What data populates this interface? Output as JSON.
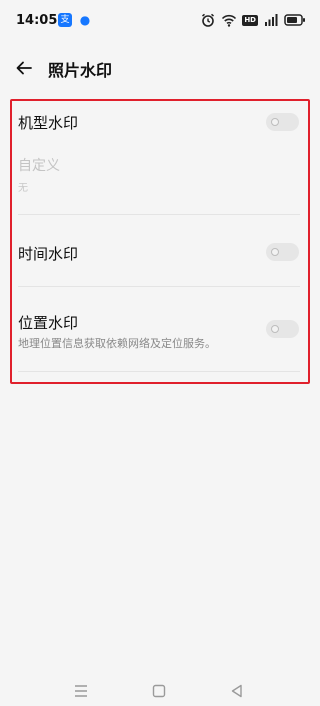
{
  "status_bar": {
    "time": "14:05",
    "left_icons": [
      "alipay-app-icon",
      "paw-app-icon"
    ],
    "right_icons": [
      "alarm-icon",
      "wifi-icon",
      "hd-icon",
      "signal-4g-icon",
      "battery-icon"
    ],
    "hd_label": "HD"
  },
  "header": {
    "title": "照片水印"
  },
  "settings": {
    "model_watermark": {
      "label": "机型水印",
      "enabled": false
    },
    "custom": {
      "label": "自定义",
      "value": "无"
    },
    "time_watermark": {
      "label": "时间水印",
      "enabled": false
    },
    "location_watermark": {
      "label": "位置水印",
      "description": "地理位置信息获取依赖网络及定位服务。",
      "enabled": false
    }
  },
  "highlight_color": "#e0202c",
  "nav_bar": {
    "buttons": [
      "menu-icon",
      "home-icon",
      "back-triangle-icon"
    ]
  }
}
